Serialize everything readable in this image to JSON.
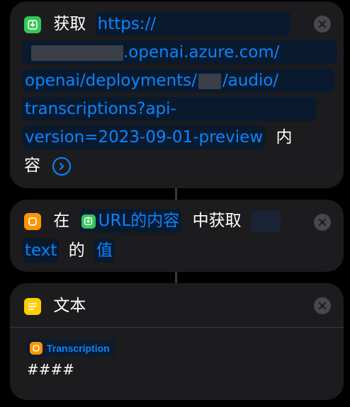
{
  "get_contents_action": {
    "verb": "获取",
    "url_line1": "https://",
    "url_line2_suffix": ".openai.azure.com/",
    "url_line3_prefix": "openai/deployments/",
    "url_line3_suffix": "/audio/",
    "url_line4": "transcriptions?api-",
    "url_line5": "version=2023-09-01-preview",
    "trailing_1": "内",
    "trailing_2": "容"
  },
  "get_dictionary_value_action": {
    "prefix": "在",
    "source_token": "URL的内容",
    "middle": "中获取",
    "key_token": "text",
    "particle": "的",
    "value_token": "值"
  },
  "text_action": {
    "title": "文本",
    "variable_label": "Transcription",
    "content": "####"
  },
  "colors": {
    "accent": "#0a84ff",
    "card_bg": "#1c1c1e",
    "green": "#34c759",
    "orange": "#ff9500",
    "yellow": "#ffcc00"
  }
}
